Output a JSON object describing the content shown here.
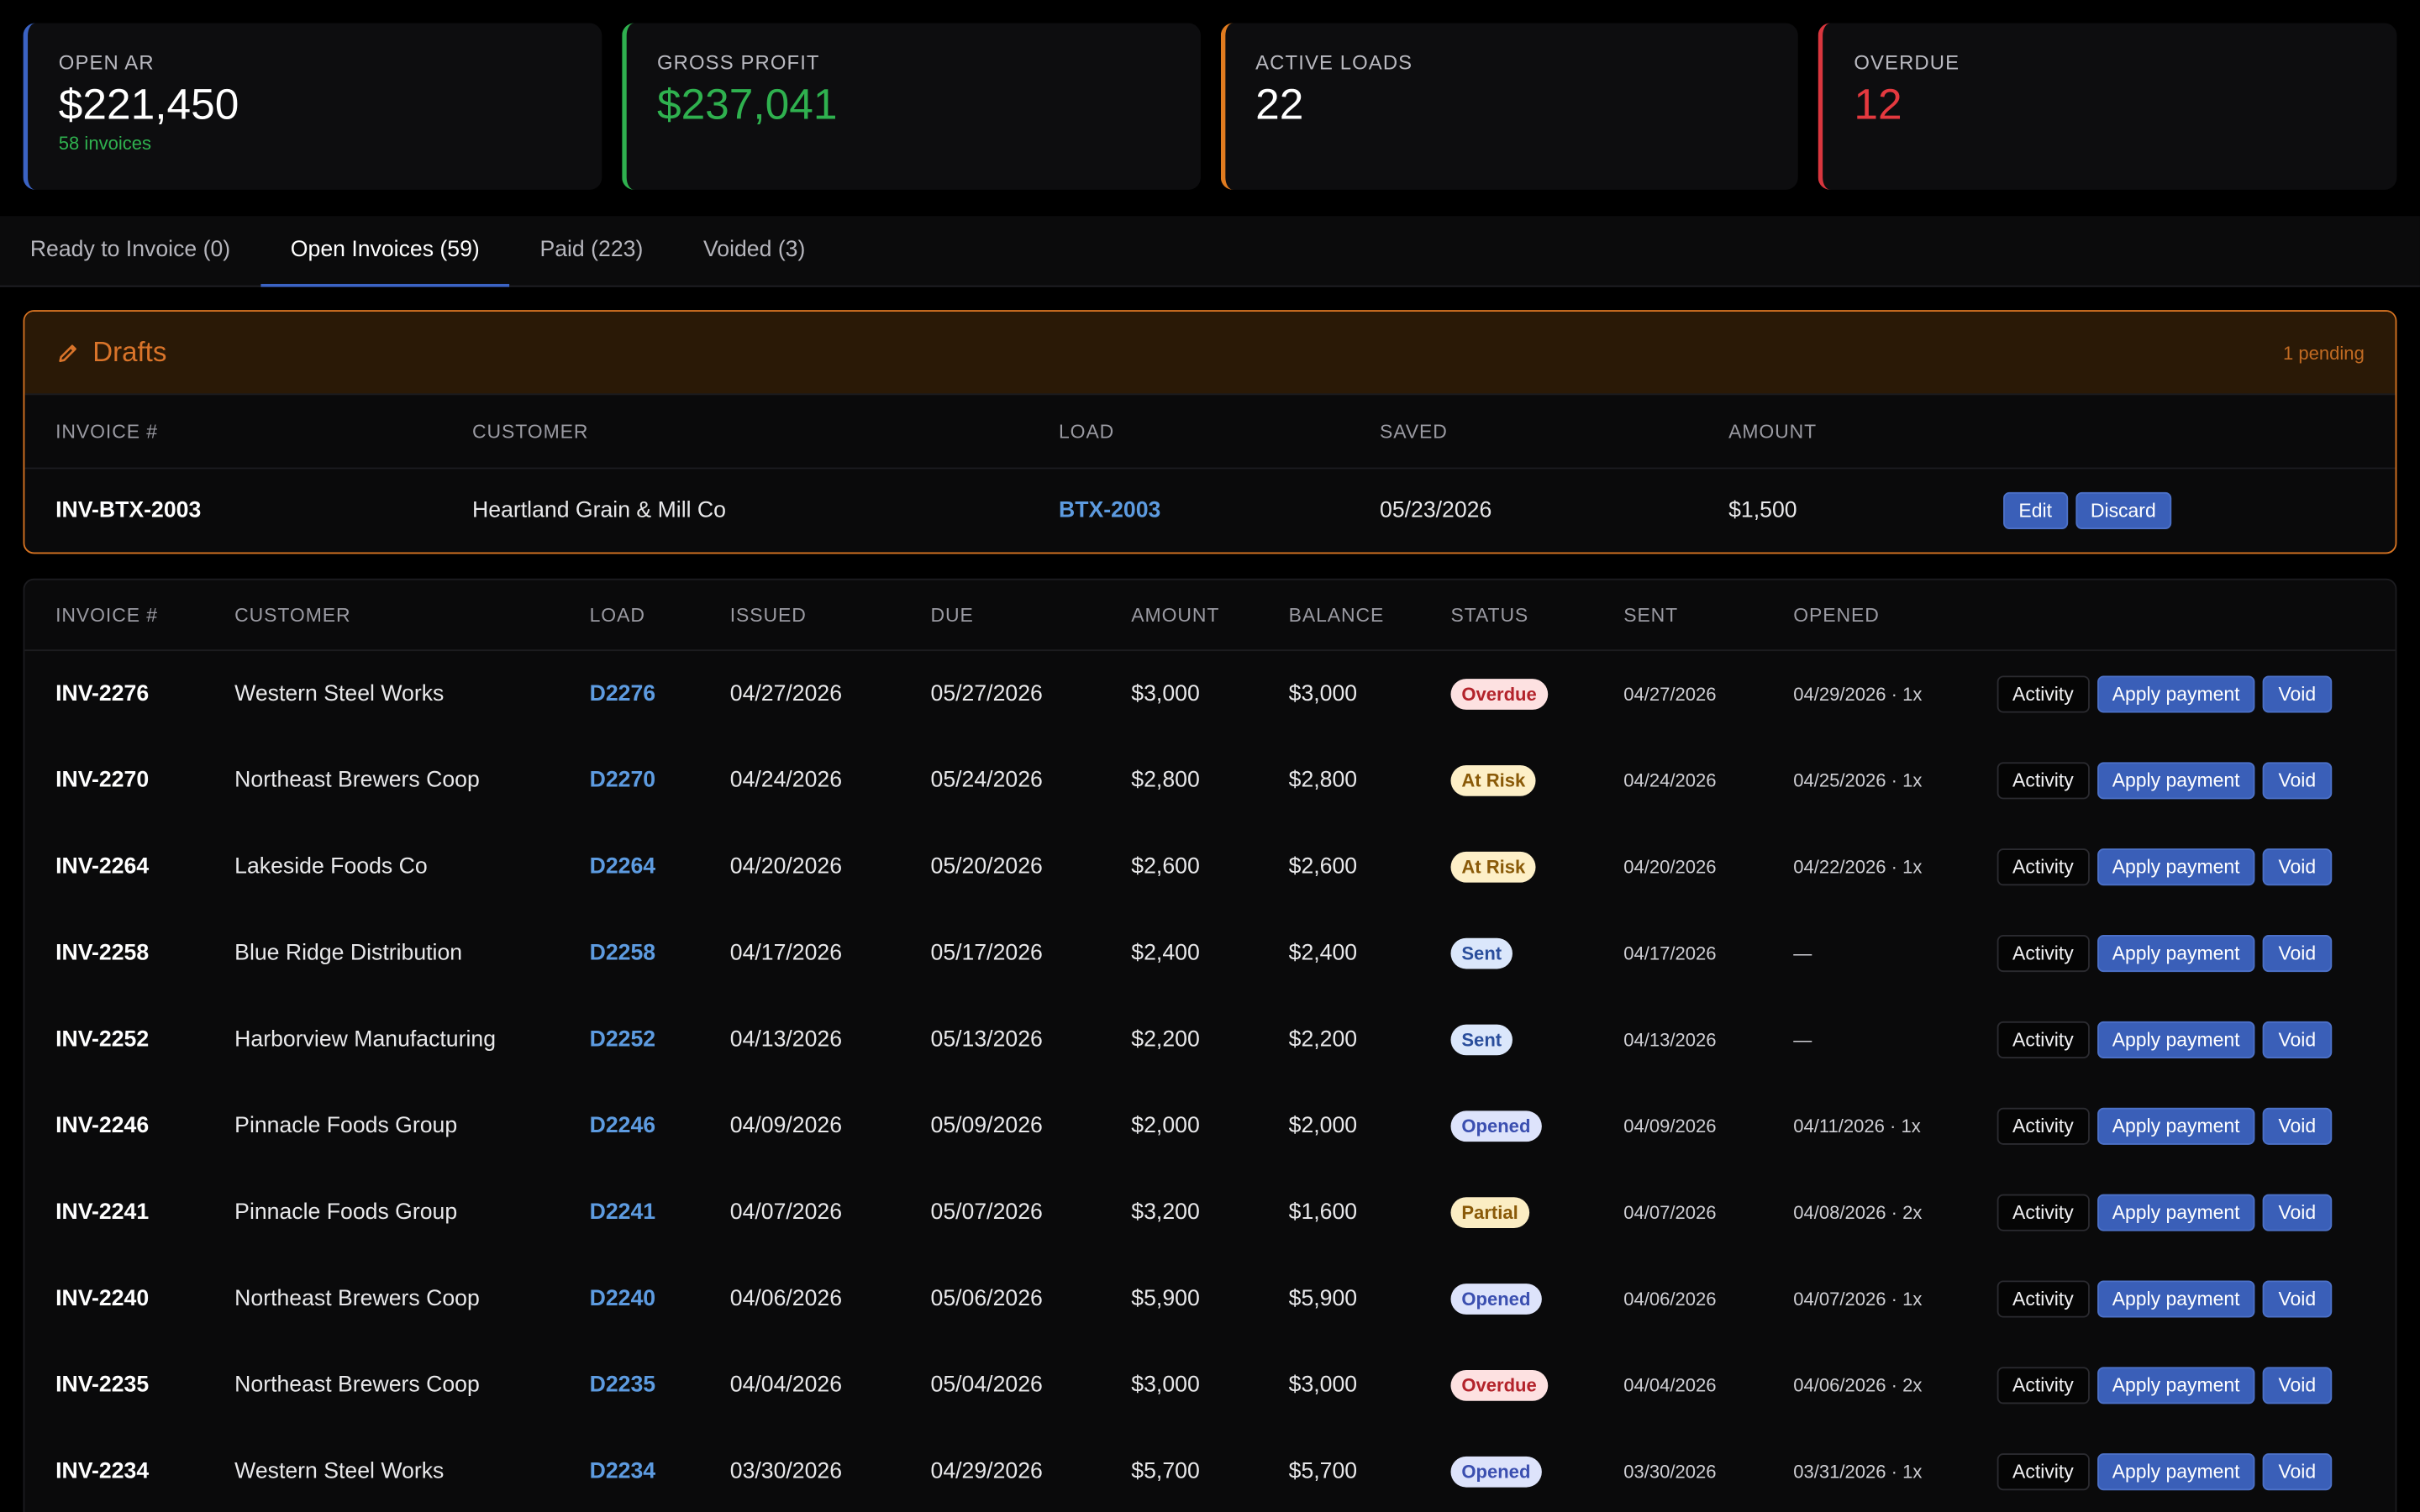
{
  "stats": [
    {
      "label": "OPEN AR",
      "value": "$221,450",
      "sub": "58 invoices"
    },
    {
      "label": "GROSS PROFIT",
      "value": "$237,041"
    },
    {
      "label": "ACTIVE LOADS",
      "value": "22"
    },
    {
      "label": "OVERDUE",
      "value": "12"
    }
  ],
  "tabs": [
    {
      "label": "Ready to Invoice (0)"
    },
    {
      "label": "Open Invoices (59)"
    },
    {
      "label": "Paid (223)"
    },
    {
      "label": "Voided (3)"
    }
  ],
  "drafts": {
    "title": "Drafts",
    "pending": "1 pending",
    "columns": [
      "INVOICE #",
      "CUSTOMER",
      "LOAD",
      "SAVED",
      "AMOUNT"
    ],
    "row": {
      "invoice": "INV-BTX-2003",
      "customer": "Heartland Grain & Mill Co",
      "load": "BTX-2003",
      "saved": "05/23/2026",
      "amount": "$1,500",
      "edit_label": "Edit",
      "discard_label": "Discard"
    }
  },
  "invoices": {
    "columns": [
      "INVOICE #",
      "CUSTOMER",
      "LOAD",
      "ISSUED",
      "DUE",
      "AMOUNT",
      "BALANCE",
      "STATUS",
      "SENT",
      "OPENED"
    ],
    "action_labels": {
      "activity": "Activity",
      "apply": "Apply payment",
      "void": "Void"
    },
    "rows": [
      {
        "invoice": "INV-2276",
        "customer": "Western Steel Works",
        "load": "D2276",
        "issued": "04/27/2026",
        "due": "05/27/2026",
        "amount": "$3,000",
        "balance": "$3,000",
        "status": "Overdue",
        "sent": "04/27/2026",
        "opened": "04/29/2026 · 1x"
      },
      {
        "invoice": "INV-2270",
        "customer": "Northeast Brewers Coop",
        "load": "D2270",
        "issued": "04/24/2026",
        "due": "05/24/2026",
        "amount": "$2,800",
        "balance": "$2,800",
        "status": "At Risk",
        "sent": "04/24/2026",
        "opened": "04/25/2026 · 1x"
      },
      {
        "invoice": "INV-2264",
        "customer": "Lakeside Foods Co",
        "load": "D2264",
        "issued": "04/20/2026",
        "due": "05/20/2026",
        "amount": "$2,600",
        "balance": "$2,600",
        "status": "At Risk",
        "sent": "04/20/2026",
        "opened": "04/22/2026 · 1x"
      },
      {
        "invoice": "INV-2258",
        "customer": "Blue Ridge Distribution",
        "load": "D2258",
        "issued": "04/17/2026",
        "due": "05/17/2026",
        "amount": "$2,400",
        "balance": "$2,400",
        "status": "Sent",
        "sent": "04/17/2026",
        "opened": "—"
      },
      {
        "invoice": "INV-2252",
        "customer": "Harborview Manufacturing",
        "load": "D2252",
        "issued": "04/13/2026",
        "due": "05/13/2026",
        "amount": "$2,200",
        "balance": "$2,200",
        "status": "Sent",
        "sent": "04/13/2026",
        "opened": "—"
      },
      {
        "invoice": "INV-2246",
        "customer": "Pinnacle Foods Group",
        "load": "D2246",
        "issued": "04/09/2026",
        "due": "05/09/2026",
        "amount": "$2,000",
        "balance": "$2,000",
        "status": "Opened",
        "sent": "04/09/2026",
        "opened": "04/11/2026 · 1x"
      },
      {
        "invoice": "INV-2241",
        "customer": "Pinnacle Foods Group",
        "load": "D2241",
        "issued": "04/07/2026",
        "due": "05/07/2026",
        "amount": "$3,200",
        "balance": "$1,600",
        "status": "Partial",
        "sent": "04/07/2026",
        "opened": "04/08/2026 · 2x"
      },
      {
        "invoice": "INV-2240",
        "customer": "Northeast Brewers Coop",
        "load": "D2240",
        "issued": "04/06/2026",
        "due": "05/06/2026",
        "amount": "$5,900",
        "balance": "$5,900",
        "status": "Opened",
        "sent": "04/06/2026",
        "opened": "04/07/2026 · 1x"
      },
      {
        "invoice": "INV-2235",
        "customer": "Northeast Brewers Coop",
        "load": "D2235",
        "issued": "04/04/2026",
        "due": "05/04/2026",
        "amount": "$3,000",
        "balance": "$3,000",
        "status": "Overdue",
        "sent": "04/04/2026",
        "opened": "04/06/2026 · 2x"
      },
      {
        "invoice": "INV-2234",
        "customer": "Western Steel Works",
        "load": "D2234",
        "issued": "03/30/2026",
        "due": "04/29/2026",
        "amount": "$5,700",
        "balance": "$5,700",
        "status": "Opened",
        "sent": "03/30/2026",
        "opened": "03/31/2026 · 1x"
      }
    ]
  },
  "colors": {
    "accent_blue": "#3b63c4",
    "profit_green": "#2fb14f",
    "warning_orange": "#e07b1f",
    "overdue_red": "#d9363e"
  }
}
